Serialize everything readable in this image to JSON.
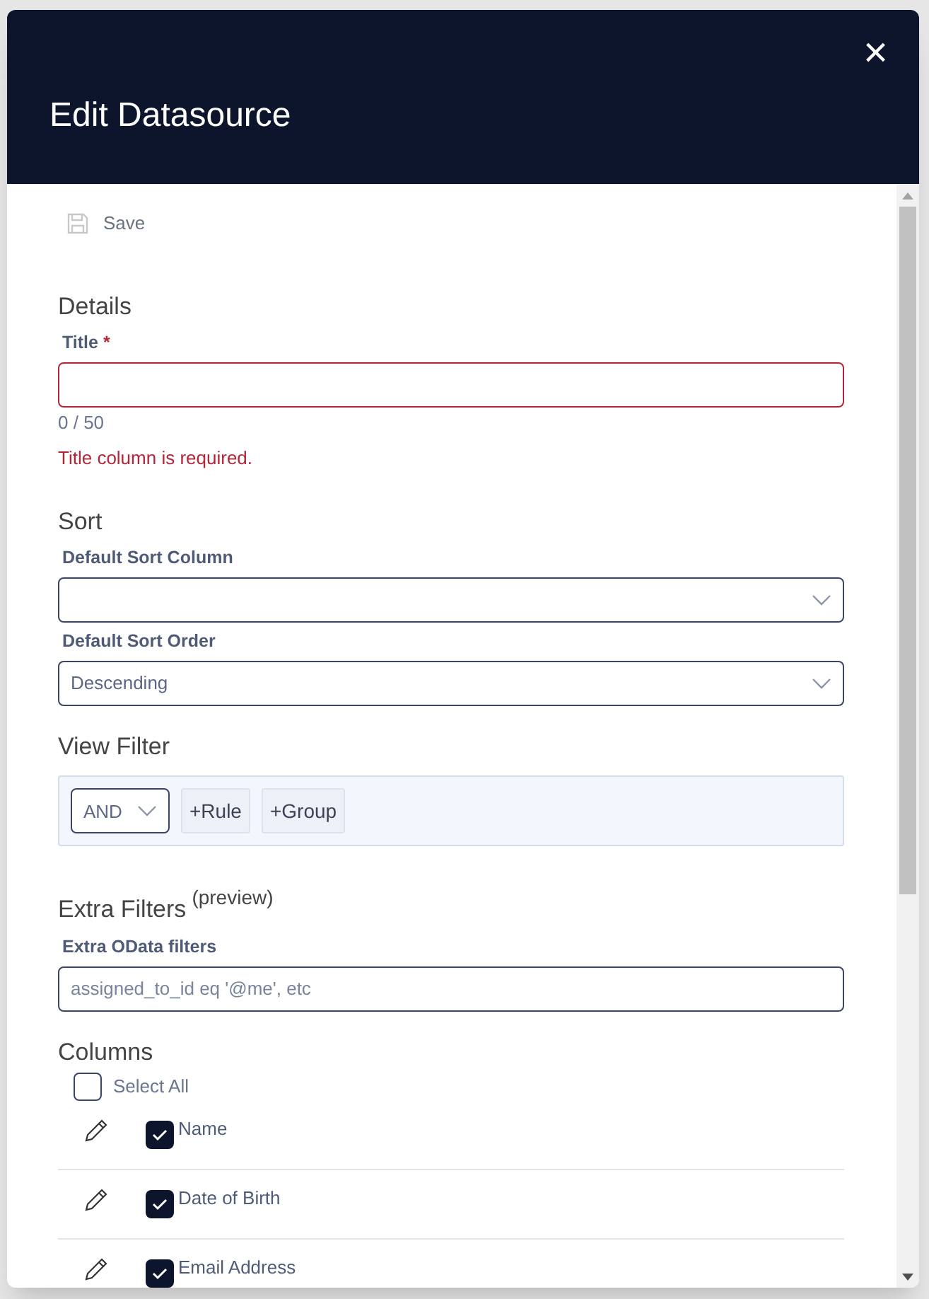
{
  "dialog": {
    "title": "Edit Datasource",
    "close": "×"
  },
  "toolbar": {
    "save": "Save",
    "disabled": true
  },
  "details": {
    "heading": "Details",
    "title_label": "Title",
    "required_mark": "*",
    "counter": "0 / 50",
    "error": "Title column is required.",
    "invalid": true
  },
  "sort": {
    "heading": "Sort",
    "column_label": "Default Sort Column",
    "order_label": "Default Sort Order",
    "order_value": "Descending"
  },
  "view_filter": {
    "heading": "View Filter",
    "operator": "AND",
    "buttons": [
      "+Rule",
      "+Group"
    ]
  },
  "extra_filters": {
    "heading": "Extra Filters",
    "note": "(preview)",
    "label": "Extra OData filters",
    "placeholder": "assigned_to_id eq '@me', etc"
  },
  "columns": {
    "heading": "Columns",
    "select_all": {
      "label": "Select All",
      "checked": false
    },
    "items": [
      {
        "label": "Name",
        "checked": true
      },
      {
        "label": "Date of Birth",
        "checked": true
      },
      {
        "label": "Email Address",
        "checked": true
      }
    ]
  }
}
